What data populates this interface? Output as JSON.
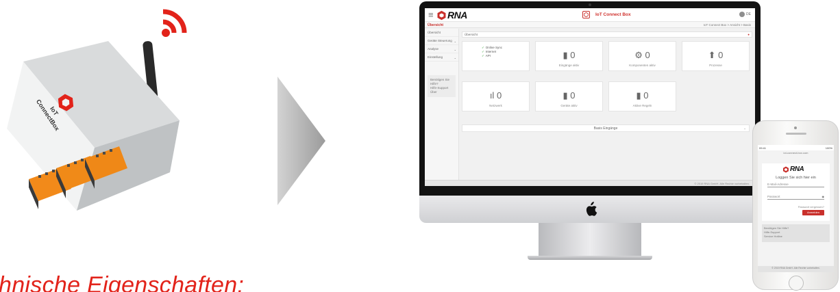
{
  "heading": "hnische Eigenschaften:",
  "device": {
    "label_line1": "IoT",
    "label_line2": "ConnectBox"
  },
  "desktop": {
    "logo_text": "RNA",
    "brand_title": "IoT Connect Box",
    "lang": "DE",
    "breadcrumb_left": "Übersicht",
    "breadcrumb_right": "IoT Connect Box > Ansicht > Basis",
    "sidebar": [
      {
        "label": "Übersicht",
        "chev": ""
      },
      {
        "label": "Geräte Steuerung",
        "chev": "⌄"
      },
      {
        "label": "Analyse",
        "chev": "⌄"
      },
      {
        "label": "Einstellung",
        "chev": "⌄"
      }
    ],
    "help_title": "Benötigen Sie Hilfe?",
    "help_line1": "Hilfe-Support",
    "help_line2": "Über",
    "search_label": "Übersicht",
    "status_items": [
      "Online Sync",
      "Internet",
      "API"
    ],
    "cards": [
      {
        "value": "0",
        "label": "Eingänge aktiv",
        "icon": "chip-icon"
      },
      {
        "value": "0",
        "label": "Komponenten aktiv",
        "icon": "gears-icon"
      },
      {
        "value": "0",
        "label": "Prozesse",
        "icon": "upload-icon"
      },
      {
        "value": "0",
        "label": "Netzwerk",
        "icon": "signal-icon"
      },
      {
        "value": "0",
        "label": "Geräte aktiv",
        "icon": "chip-icon"
      },
      {
        "value": "0",
        "label": "Aktive Regeln",
        "icon": "chip-icon"
      }
    ],
    "collapsible": "Basis Eingänge",
    "footer": "© 2019 RNA GmbH. Alle Rechte vorbehalten."
  },
  "phone": {
    "time": "09:41",
    "battery": "100%",
    "url": "iot-connect-box.com",
    "logo_text": "RNA",
    "title": "Loggen Sie sich hier ein",
    "email_placeholder": "E-Mail-Adresse",
    "password_placeholder": "Passwort",
    "forgot": "Passwort vergessen?",
    "login_button": "Anmelden",
    "help_title": "Benötigen Sie Hilfe?",
    "help_line1": "Hilfe-Support",
    "help_line2": "Service Hotline",
    "footer": "© 2019 RNA GmbH. Alle Rechte vorbehalten."
  },
  "colors": {
    "accent": "#c9302c",
    "heading": "#e2231a"
  }
}
